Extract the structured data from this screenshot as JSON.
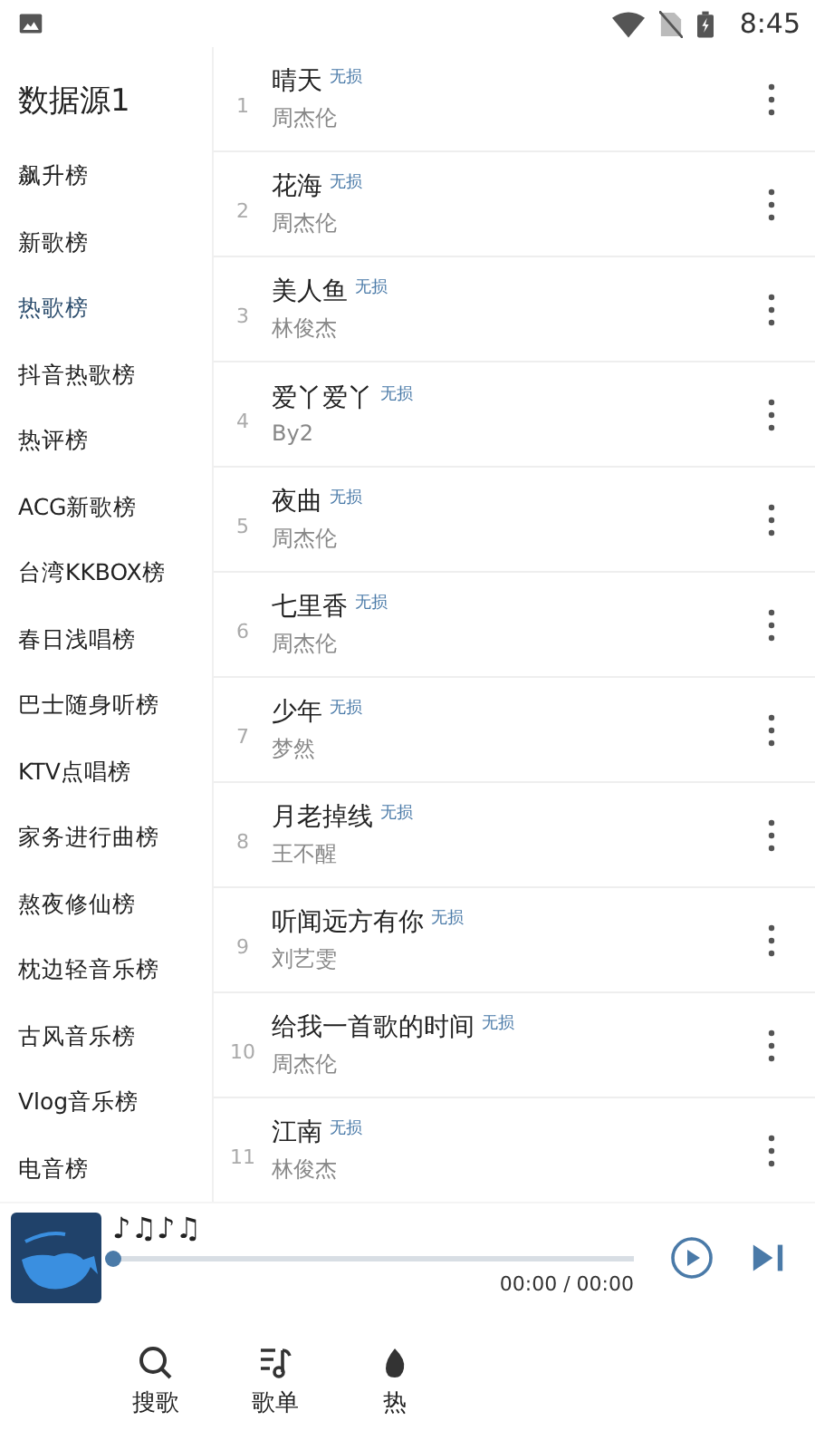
{
  "status_bar": {
    "time": "8:45"
  },
  "sidebar": {
    "title": "数据源1",
    "items": [
      {
        "label": "飙升榜",
        "selected": false
      },
      {
        "label": "新歌榜",
        "selected": false
      },
      {
        "label": "热歌榜",
        "selected": true
      },
      {
        "label": "抖音热歌榜",
        "selected": false
      },
      {
        "label": "热评榜",
        "selected": false
      },
      {
        "label": "ACG新歌榜",
        "selected": false
      },
      {
        "label": "台湾KKBOX榜",
        "selected": false
      },
      {
        "label": "春日浅唱榜",
        "selected": false
      },
      {
        "label": "巴士随身听榜",
        "selected": false
      },
      {
        "label": "KTV点唱榜",
        "selected": false
      },
      {
        "label": "家务进行曲榜",
        "selected": false
      },
      {
        "label": "熬夜修仙榜",
        "selected": false
      },
      {
        "label": "枕边轻音乐榜",
        "selected": false
      },
      {
        "label": "古风音乐榜",
        "selected": false
      },
      {
        "label": "Vlog音乐榜",
        "selected": false
      },
      {
        "label": "电音榜",
        "selected": false
      }
    ]
  },
  "songs": [
    {
      "index": "1",
      "title": "晴天",
      "quality": "无损",
      "artist": "周杰伦"
    },
    {
      "index": "2",
      "title": "花海",
      "quality": "无损",
      "artist": "周杰伦"
    },
    {
      "index": "3",
      "title": "美人鱼",
      "quality": "无损",
      "artist": "林俊杰"
    },
    {
      "index": "4",
      "title": "爱丫爱丫",
      "quality": "无损",
      "artist": "By2"
    },
    {
      "index": "5",
      "title": "夜曲",
      "quality": "无损",
      "artist": "周杰伦"
    },
    {
      "index": "6",
      "title": "七里香",
      "quality": "无损",
      "artist": "周杰伦"
    },
    {
      "index": "7",
      "title": "少年",
      "quality": "无损",
      "artist": "梦然"
    },
    {
      "index": "8",
      "title": "月老掉线",
      "quality": "无损",
      "artist": "王不醒"
    },
    {
      "index": "9",
      "title": "听闻远方有你",
      "quality": "无损",
      "artist": "刘艺雯"
    },
    {
      "index": "10",
      "title": "给我一首歌的时间",
      "quality": "无损",
      "artist": "周杰伦"
    },
    {
      "index": "11",
      "title": "江南",
      "quality": "无损",
      "artist": "林俊杰"
    }
  ],
  "player": {
    "title": "♪♫♪♫",
    "level": 0,
    "time": "00:00 / 00:00"
  },
  "nav": [
    {
      "label": "搜歌",
      "kind": "search"
    },
    {
      "label": "歌单",
      "kind": "playlist"
    },
    {
      "label": "热",
      "kind": "hot"
    }
  ]
}
